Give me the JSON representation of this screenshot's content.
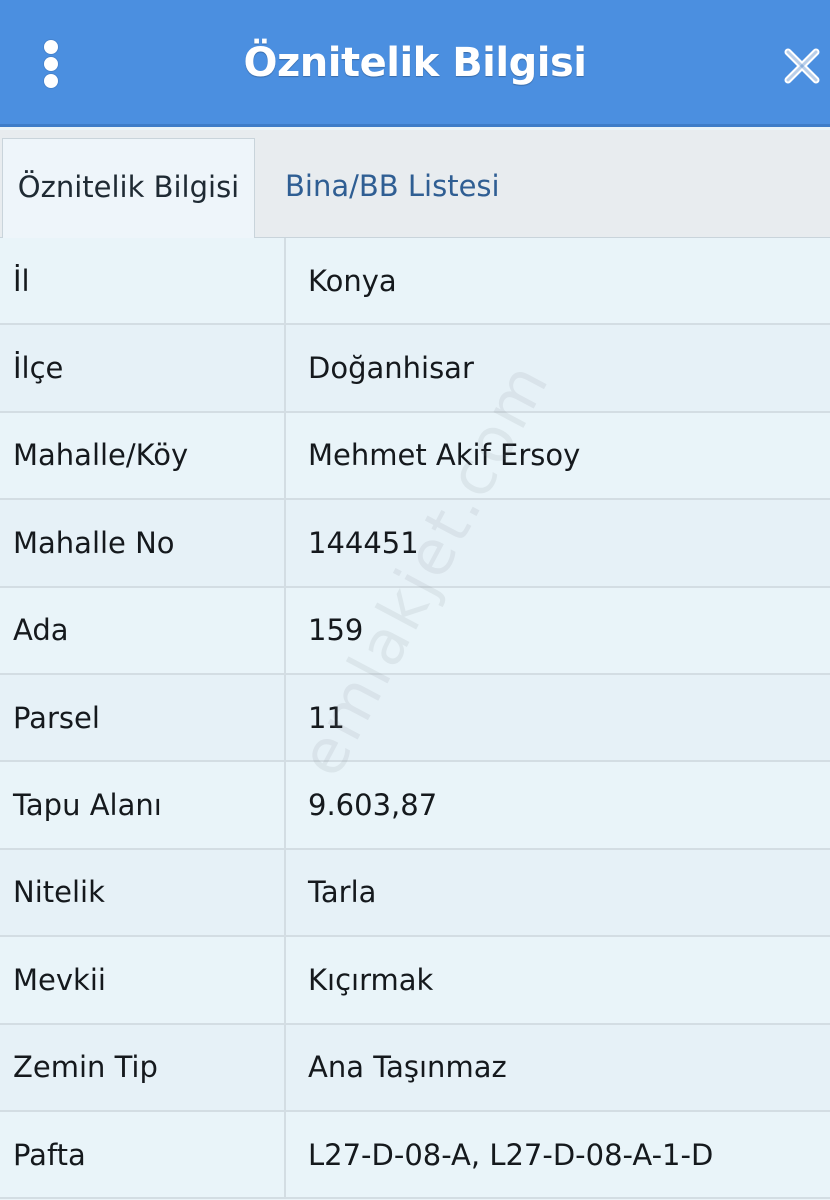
{
  "header": {
    "title": "Öznitelik Bilgisi",
    "menu_icon": "vertical-dots-icon",
    "close_icon": "close-x-icon",
    "background_color": "#4b8fe0"
  },
  "tabs": [
    {
      "label": "Öznitelik Bilgisi",
      "active": true
    },
    {
      "label": "Bina/BB Listesi",
      "active": false
    }
  ],
  "attributes": [
    {
      "label": "İl",
      "value": "Konya"
    },
    {
      "label": "İlçe",
      "value": "Doğanhisar"
    },
    {
      "label": "Mahalle/Köy",
      "value": "Mehmet Akif Ersoy"
    },
    {
      "label": "Mahalle No",
      "value": "144451"
    },
    {
      "label": "Ada",
      "value": "159"
    },
    {
      "label": "Parsel",
      "value": "11"
    },
    {
      "label": "Tapu Alanı",
      "value": "9.603,87"
    },
    {
      "label": "Nitelik",
      "value": "Tarla"
    },
    {
      "label": "Mevkii",
      "value": "Kıçırmak"
    },
    {
      "label": "Zemin Tip",
      "value": "Ana Taşınmaz"
    },
    {
      "label": "Pafta",
      "value": "L27-D-08-A, L27-D-08-A-1-D"
    }
  ],
  "watermark": "emlakjet.com"
}
